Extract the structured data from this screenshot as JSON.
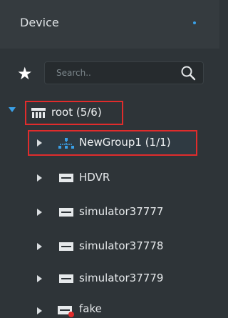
{
  "header": {
    "title": "Device"
  },
  "search": {
    "placeholder": "Search.."
  },
  "tree": {
    "root": {
      "label": "root (5/6)"
    },
    "group": {
      "label": "NewGroup1 (1/1)"
    },
    "devices": [
      {
        "label": "HDVR"
      },
      {
        "label": "simulator37777"
      },
      {
        "label": "simulator37778"
      },
      {
        "label": "simulator37779"
      },
      {
        "label": "fake"
      }
    ]
  },
  "colors": {
    "accent": "#3aa0e8",
    "highlight": "#e02c2c",
    "background": "#2e3438"
  },
  "icons": [
    "star-icon",
    "search-icon",
    "root-group-icon",
    "group-icon",
    "device-icon",
    "offline-device-icon"
  ]
}
